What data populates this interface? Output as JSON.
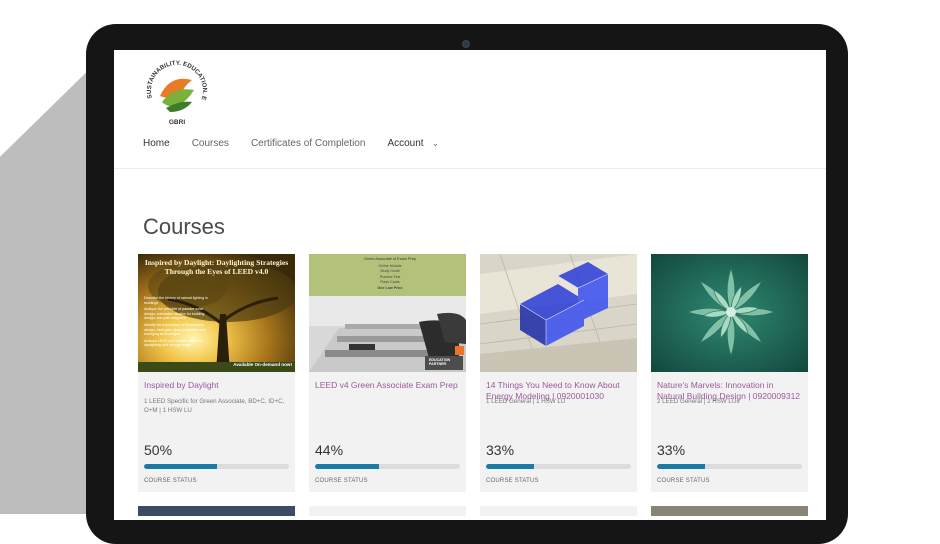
{
  "logo": {
    "ring_text": "SUSTAINABILITY. EDUCATION. EMPOWERMENT.",
    "brand": "GBRI"
  },
  "nav": {
    "items": [
      {
        "label": "Home",
        "active": true
      },
      {
        "label": "Courses"
      },
      {
        "label": "Certificates of Completion"
      },
      {
        "label": "Account",
        "dropdown": true
      }
    ],
    "chevron": "⌄"
  },
  "page": {
    "title": "Courses"
  },
  "courses": [
    {
      "title": "Inspired by Daylight",
      "meta": "1 LEED Specific for Green Associate, BD+C, ID+C, O+M | 1 HSW LU",
      "progress_label": "50%",
      "progress": 0.5,
      "status_label": "COURSE STATUS",
      "thumb": {
        "headline": "Inspired by Daylight: Daylighting Strategies Through the Eyes of LEED v4.0",
        "bullets": [
          "Describe the history of natural lighting in buildings",
          "Analyze the principle of passive solar design, orientation studies for building design, sun path diagrams",
          "Identify the importance of fenestration design, heat gain, glass properties and emerging technologies",
          "Analyze LEED v4.0 credits related to daylighting and energy usage"
        ],
        "badge": "Available On-demand now!"
      }
    },
    {
      "title": "LEED v4 Green Associate Exam Prep",
      "meta": "",
      "progress_label": "44%",
      "progress": 0.44,
      "status_label": "COURSE STATUS",
      "thumb": {
        "heading": "Green Associate of Exam Prep",
        "lines": [
          "Online Module",
          "Study Guide",
          "Practice Test",
          "Flash Cards",
          "One Low Price"
        ],
        "partner": "EDUCATION PARTNER"
      }
    },
    {
      "title": "14 Things You Need to Know About Energy Modeling | 0920001030",
      "meta": "1 LEED General | 1 HSW LU",
      "progress_label": "33%",
      "progress": 0.33,
      "status_label": "COURSE STATUS"
    },
    {
      "title": "Nature's Marvels: Innovation in Natural Building Design | 0920009312",
      "meta": "2 LEED General | 2 HSW LUs",
      "progress_label": "33%",
      "progress": 0.33,
      "status_label": "COURSE STATUS"
    }
  ],
  "colors": {
    "accent": "#1b7aa6",
    "title_purple": "#9a5a9a",
    "bezel": "#151515",
    "card_bg": "#f2f2f2"
  }
}
